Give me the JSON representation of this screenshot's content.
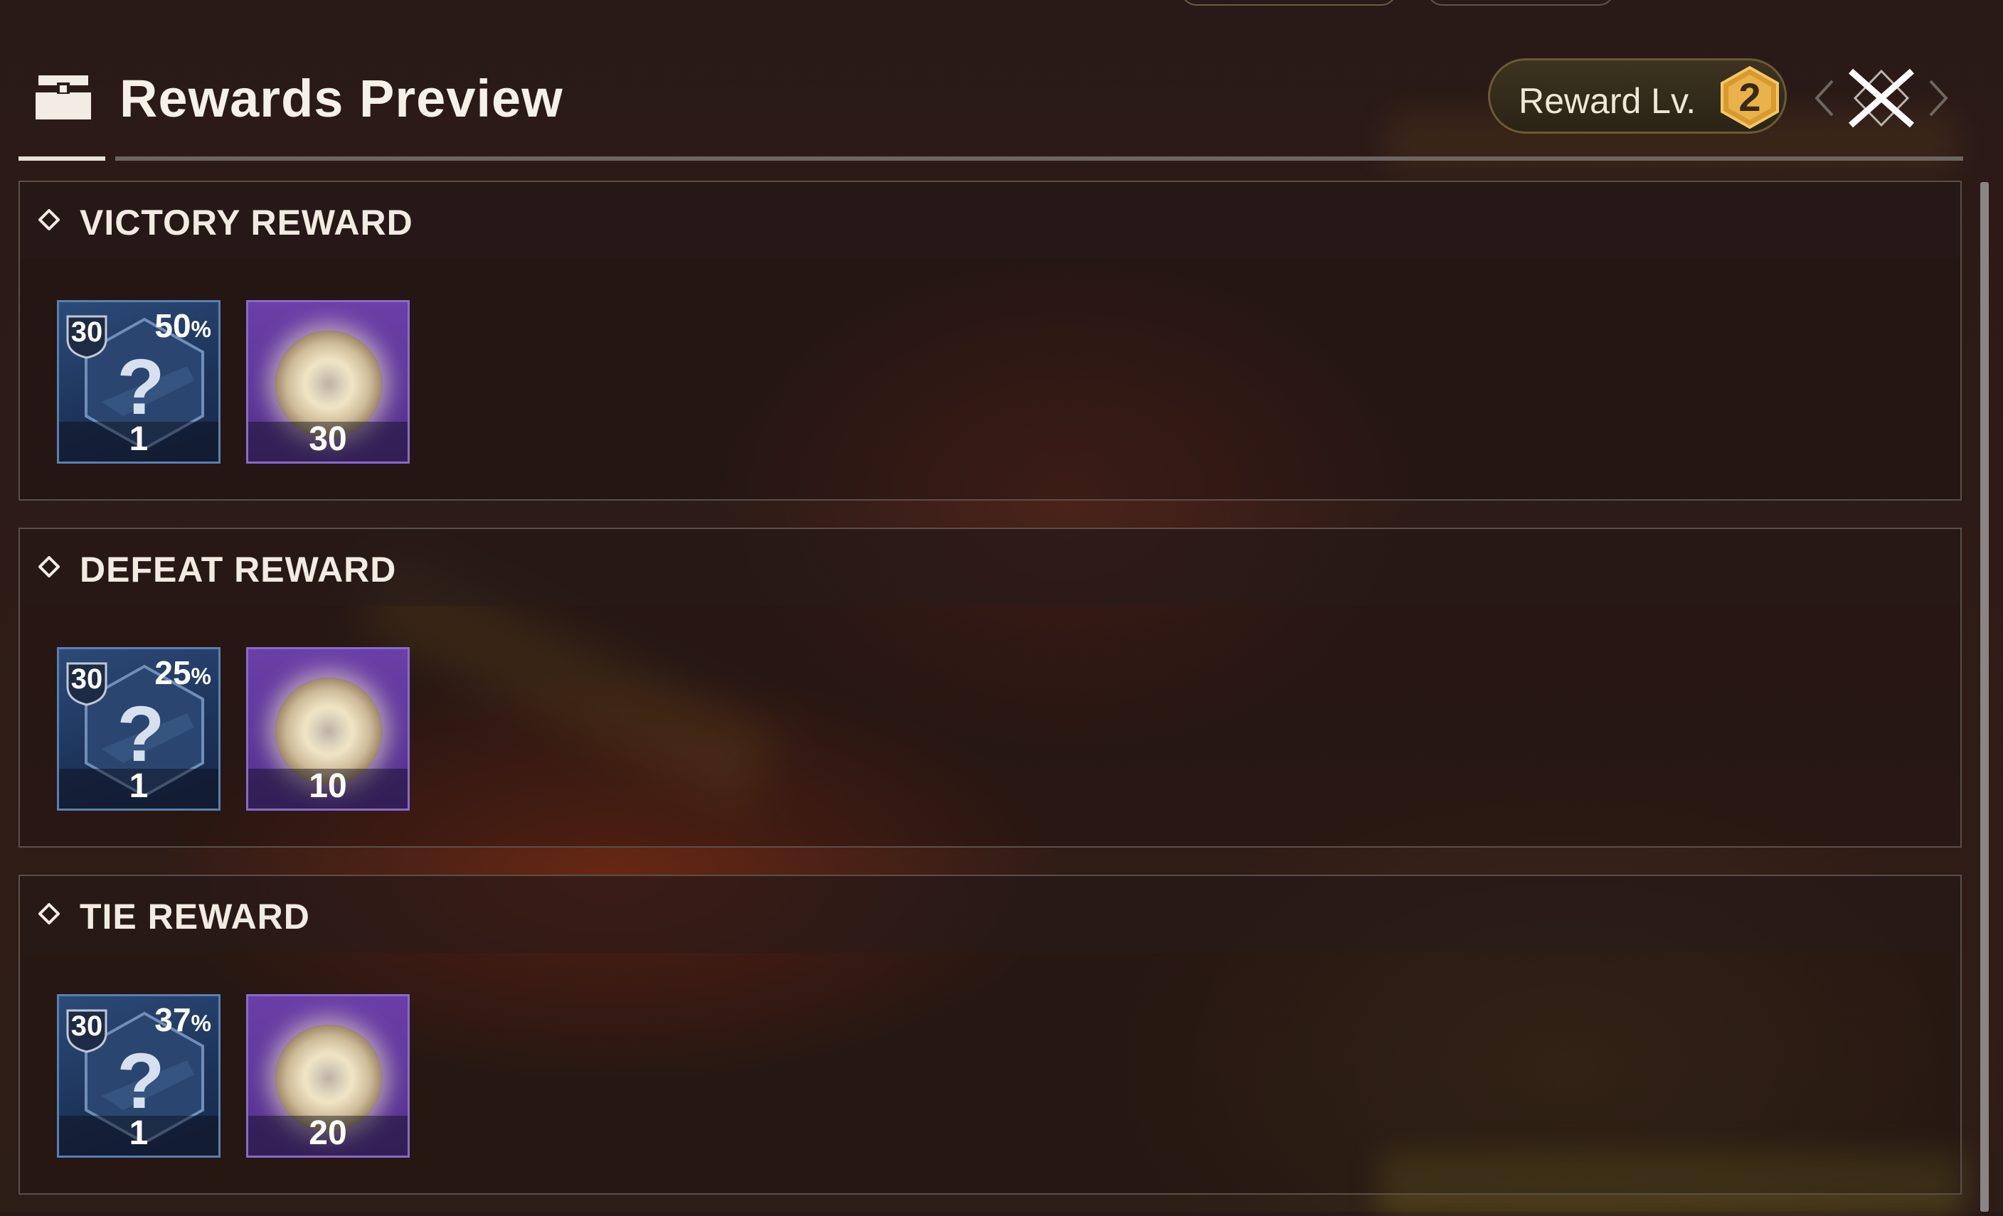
{
  "header": {
    "title": "Rewards Preview",
    "reward_level": {
      "label": "Reward Lv.",
      "value": "2"
    }
  },
  "sections": [
    {
      "title": "VICTORY REWARD",
      "items": [
        {
          "kind": "mystery-weapon",
          "level": "30",
          "chance": "50",
          "chance_unit": "%",
          "count": "1"
        },
        {
          "kind": "light-orb",
          "count": "30"
        }
      ]
    },
    {
      "title": "DEFEAT REWARD",
      "items": [
        {
          "kind": "mystery-weapon",
          "level": "30",
          "chance": "25",
          "chance_unit": "%",
          "count": "1"
        },
        {
          "kind": "light-orb",
          "count": "10"
        }
      ]
    },
    {
      "title": "TIE REWARD",
      "items": [
        {
          "kind": "mystery-weapon",
          "level": "30",
          "chance": "37",
          "chance_unit": "%",
          "count": "1"
        },
        {
          "kind": "light-orb",
          "count": "20"
        }
      ]
    }
  ],
  "icons": {
    "header": "chest-icon",
    "close": "close-icon",
    "prev": "chevron-left-icon",
    "next": "chevron-right-icon",
    "section_marker": "diamond-icon"
  },
  "colors": {
    "background": "#2c1c17",
    "tier_blue": "#2c4a78",
    "tier_purple": "#6a3fa8",
    "badge_gold": "#e0a83a"
  }
}
